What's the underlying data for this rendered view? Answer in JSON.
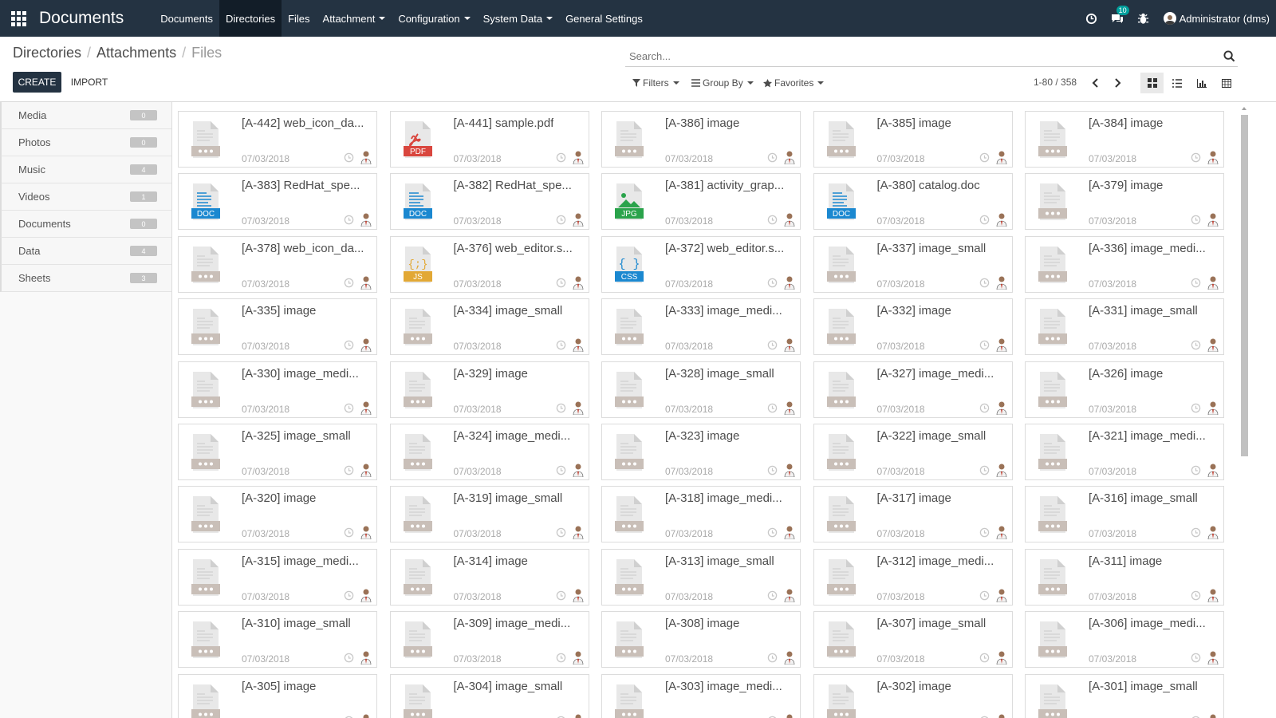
{
  "app": {
    "title": "Documents"
  },
  "menu": [
    {
      "label": "Documents",
      "caret": false,
      "active": false
    },
    {
      "label": "Directories",
      "caret": false,
      "active": true
    },
    {
      "label": "Files",
      "caret": false,
      "active": false
    },
    {
      "label": "Attachment",
      "caret": true,
      "active": false
    },
    {
      "label": "Configuration",
      "caret": true,
      "active": false
    },
    {
      "label": "System Data",
      "caret": true,
      "active": false
    },
    {
      "label": "General Settings",
      "caret": false,
      "active": false
    }
  ],
  "systray": {
    "messages_count": "10",
    "user": "Administrator (dms)"
  },
  "breadcrumb": [
    "Directories",
    "Attachments",
    "Files"
  ],
  "search": {
    "placeholder": "Search..."
  },
  "buttons": {
    "create": "CREATE",
    "import": "IMPORT"
  },
  "filters": {
    "filters": "Filters",
    "group_by": "Group By",
    "favorites": "Favorites"
  },
  "pager": {
    "value": "1-80 / 358"
  },
  "colors": {
    "navbar": "#243342",
    "navbar_active": "#121d28",
    "pdf": "#d9463e",
    "doc": "#1b88d0",
    "jpg": "#2aa34b",
    "js": "#e2a835",
    "css": "#1b88d0",
    "generic": "#c9bfb8"
  },
  "sidebar": [
    {
      "label": "Media",
      "count": "0"
    },
    {
      "label": "Photos",
      "count": "0"
    },
    {
      "label": "Music",
      "count": "4"
    },
    {
      "label": "Videos",
      "count": "1"
    },
    {
      "label": "Documents",
      "count": "0"
    },
    {
      "label": "Data",
      "count": "4"
    },
    {
      "label": "Sheets",
      "count": "3"
    }
  ],
  "files": [
    {
      "title": "[A-442] web_icon_da...",
      "date": "07/03/2018",
      "icon": "generic"
    },
    {
      "title": "[A-441] sample.pdf",
      "date": "07/03/2018",
      "icon": "pdf"
    },
    {
      "title": "[A-386] image",
      "date": "07/03/2018",
      "icon": "generic"
    },
    {
      "title": "[A-385] image",
      "date": "07/03/2018",
      "icon": "generic"
    },
    {
      "title": "[A-384] image",
      "date": "07/03/2018",
      "icon": "generic"
    },
    {
      "title": "[A-383] RedHat_spe...",
      "date": "07/03/2018",
      "icon": "doc"
    },
    {
      "title": "[A-382] RedHat_spe...",
      "date": "07/03/2018",
      "icon": "doc"
    },
    {
      "title": "[A-381] activity_grap...",
      "date": "07/03/2018",
      "icon": "jpg"
    },
    {
      "title": "[A-380] catalog.doc",
      "date": "07/03/2018",
      "icon": "doc"
    },
    {
      "title": "[A-379] image",
      "date": "07/03/2018",
      "icon": "generic"
    },
    {
      "title": "[A-378] web_icon_da...",
      "date": "07/03/2018",
      "icon": "generic"
    },
    {
      "title": "[A-376] web_editor.s...",
      "date": "07/03/2018",
      "icon": "js"
    },
    {
      "title": "[A-372] web_editor.s...",
      "date": "07/03/2018",
      "icon": "css"
    },
    {
      "title": "[A-337] image_small",
      "date": "07/03/2018",
      "icon": "generic"
    },
    {
      "title": "[A-336] image_medi...",
      "date": "07/03/2018",
      "icon": "generic"
    },
    {
      "title": "[A-335] image",
      "date": "07/03/2018",
      "icon": "generic"
    },
    {
      "title": "[A-334] image_small",
      "date": "07/03/2018",
      "icon": "generic"
    },
    {
      "title": "[A-333] image_medi...",
      "date": "07/03/2018",
      "icon": "generic"
    },
    {
      "title": "[A-332] image",
      "date": "07/03/2018",
      "icon": "generic"
    },
    {
      "title": "[A-331] image_small",
      "date": "07/03/2018",
      "icon": "generic"
    },
    {
      "title": "[A-330] image_medi...",
      "date": "07/03/2018",
      "icon": "generic"
    },
    {
      "title": "[A-329] image",
      "date": "07/03/2018",
      "icon": "generic"
    },
    {
      "title": "[A-328] image_small",
      "date": "07/03/2018",
      "icon": "generic"
    },
    {
      "title": "[A-327] image_medi...",
      "date": "07/03/2018",
      "icon": "generic"
    },
    {
      "title": "[A-326] image",
      "date": "07/03/2018",
      "icon": "generic"
    },
    {
      "title": "[A-325] image_small",
      "date": "07/03/2018",
      "icon": "generic"
    },
    {
      "title": "[A-324] image_medi...",
      "date": "07/03/2018",
      "icon": "generic"
    },
    {
      "title": "[A-323] image",
      "date": "07/03/2018",
      "icon": "generic"
    },
    {
      "title": "[A-322] image_small",
      "date": "07/03/2018",
      "icon": "generic"
    },
    {
      "title": "[A-321] image_medi...",
      "date": "07/03/2018",
      "icon": "generic"
    },
    {
      "title": "[A-320] image",
      "date": "07/03/2018",
      "icon": "generic"
    },
    {
      "title": "[A-319] image_small",
      "date": "07/03/2018",
      "icon": "generic"
    },
    {
      "title": "[A-318] image_medi...",
      "date": "07/03/2018",
      "icon": "generic"
    },
    {
      "title": "[A-317] image",
      "date": "07/03/2018",
      "icon": "generic"
    },
    {
      "title": "[A-316] image_small",
      "date": "07/03/2018",
      "icon": "generic"
    },
    {
      "title": "[A-315] image_medi...",
      "date": "07/03/2018",
      "icon": "generic"
    },
    {
      "title": "[A-314] image",
      "date": "07/03/2018",
      "icon": "generic"
    },
    {
      "title": "[A-313] image_small",
      "date": "07/03/2018",
      "icon": "generic"
    },
    {
      "title": "[A-312] image_medi...",
      "date": "07/03/2018",
      "icon": "generic"
    },
    {
      "title": "[A-311] image",
      "date": "07/03/2018",
      "icon": "generic"
    },
    {
      "title": "[A-310] image_small",
      "date": "07/03/2018",
      "icon": "generic"
    },
    {
      "title": "[A-309] image_medi...",
      "date": "07/03/2018",
      "icon": "generic"
    },
    {
      "title": "[A-308] image",
      "date": "07/03/2018",
      "icon": "generic"
    },
    {
      "title": "[A-307] image_small",
      "date": "07/03/2018",
      "icon": "generic"
    },
    {
      "title": "[A-306] image_medi...",
      "date": "07/03/2018",
      "icon": "generic"
    },
    {
      "title": "[A-305] image",
      "date": "",
      "icon": "generic"
    },
    {
      "title": "[A-304] image_small",
      "date": "",
      "icon": "generic"
    },
    {
      "title": "[A-303] image_medi...",
      "date": "",
      "icon": "generic"
    },
    {
      "title": "[A-302] image",
      "date": "",
      "icon": "generic"
    },
    {
      "title": "[A-301] image_small",
      "date": "",
      "icon": "generic"
    }
  ]
}
